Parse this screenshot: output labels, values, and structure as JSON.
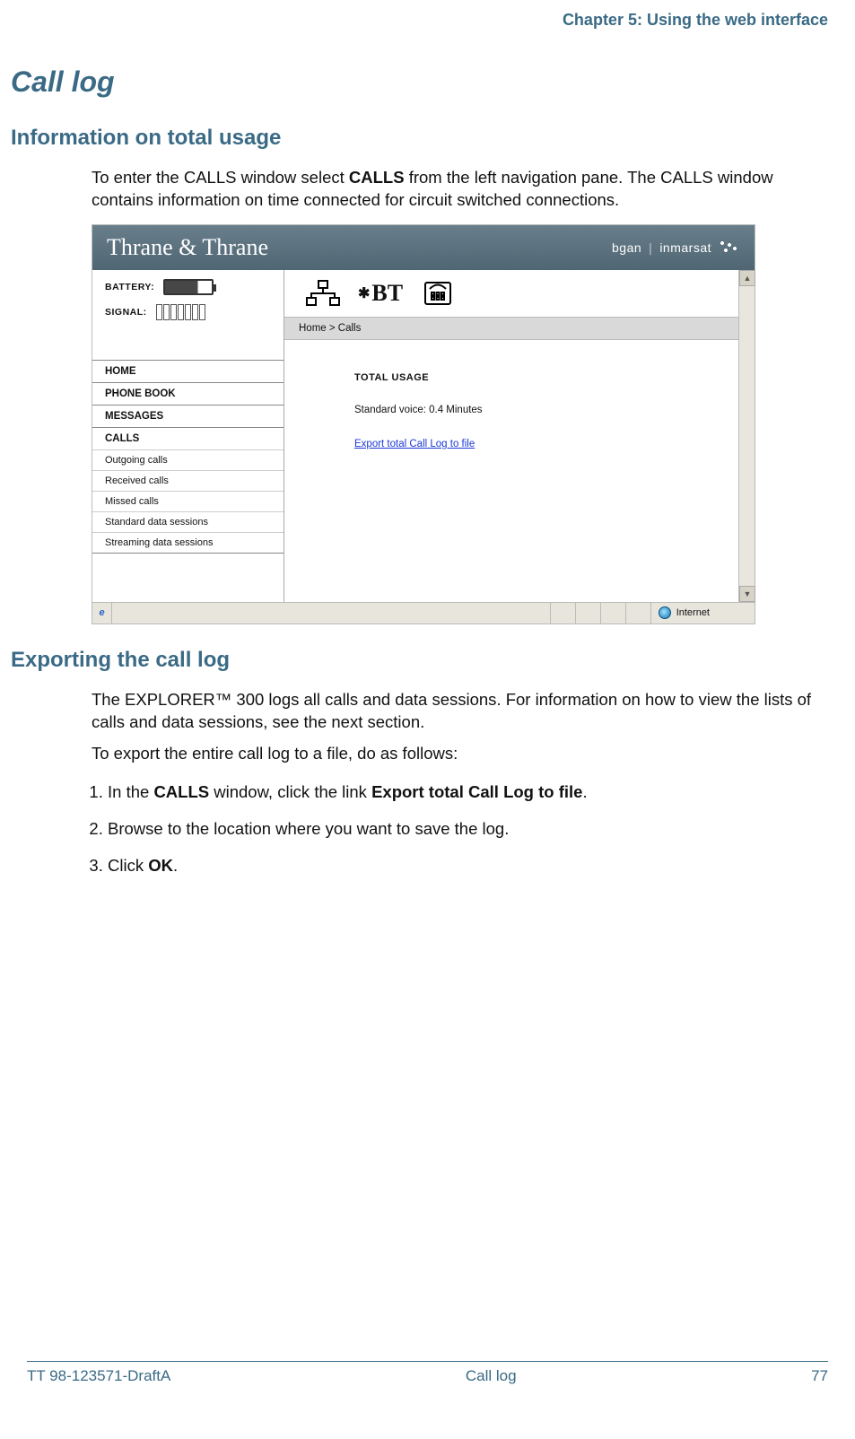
{
  "header": {
    "chapter": "Chapter 5: Using the web interface"
  },
  "section": {
    "title": "Call log",
    "sub1": "Information on total usage",
    "intro_pre": "To enter the CALLS window select ",
    "intro_bold1": "CALLS",
    "intro_post": " from the left navigation pane. The CALLS window contains information on time connected for circuit switched connections.",
    "sub2": "Exporting the call log",
    "p2": "The EXPLORER™ 300 logs all calls and data sessions. For information on how to view the lists of calls and data sessions, see the next section.",
    "p3": "To export the entire call log to a file, do as follows:",
    "steps": [
      {
        "pre": "In the ",
        "b1": "CALLS",
        "mid": " window, click the link ",
        "b2": "Export total Call Log to file",
        "post": "."
      },
      {
        "text": "Browse to the location where you want to save the log."
      },
      {
        "pre": "Click ",
        "b1": "OK",
        "post": "."
      }
    ]
  },
  "shot": {
    "brand": "Thrane & Thrane",
    "brand_right_a": "bgan",
    "brand_right_b": "inmarsat",
    "battery_label": "BATTERY:",
    "signal_label": "SIGNAL:",
    "nav": {
      "home": "HOME",
      "phonebook": "PHONE BOOK",
      "messages": "MESSAGES",
      "calls": "CALLS",
      "subs": [
        "Outgoing calls",
        "Received calls",
        "Missed calls",
        "Standard data sessions",
        "Streaming data sessions"
      ]
    },
    "breadcrumb": "Home > Calls",
    "content": {
      "title": "TOTAL USAGE",
      "row": "Standard voice: 0.4 Minutes",
      "export_link": "Export total Call Log to file"
    },
    "status_zone": "Internet",
    "ie_scheme": "e",
    "bt_label": "BT"
  },
  "footer": {
    "left": "TT 98-123571-DraftA",
    "center": "Call log",
    "right": "77"
  }
}
